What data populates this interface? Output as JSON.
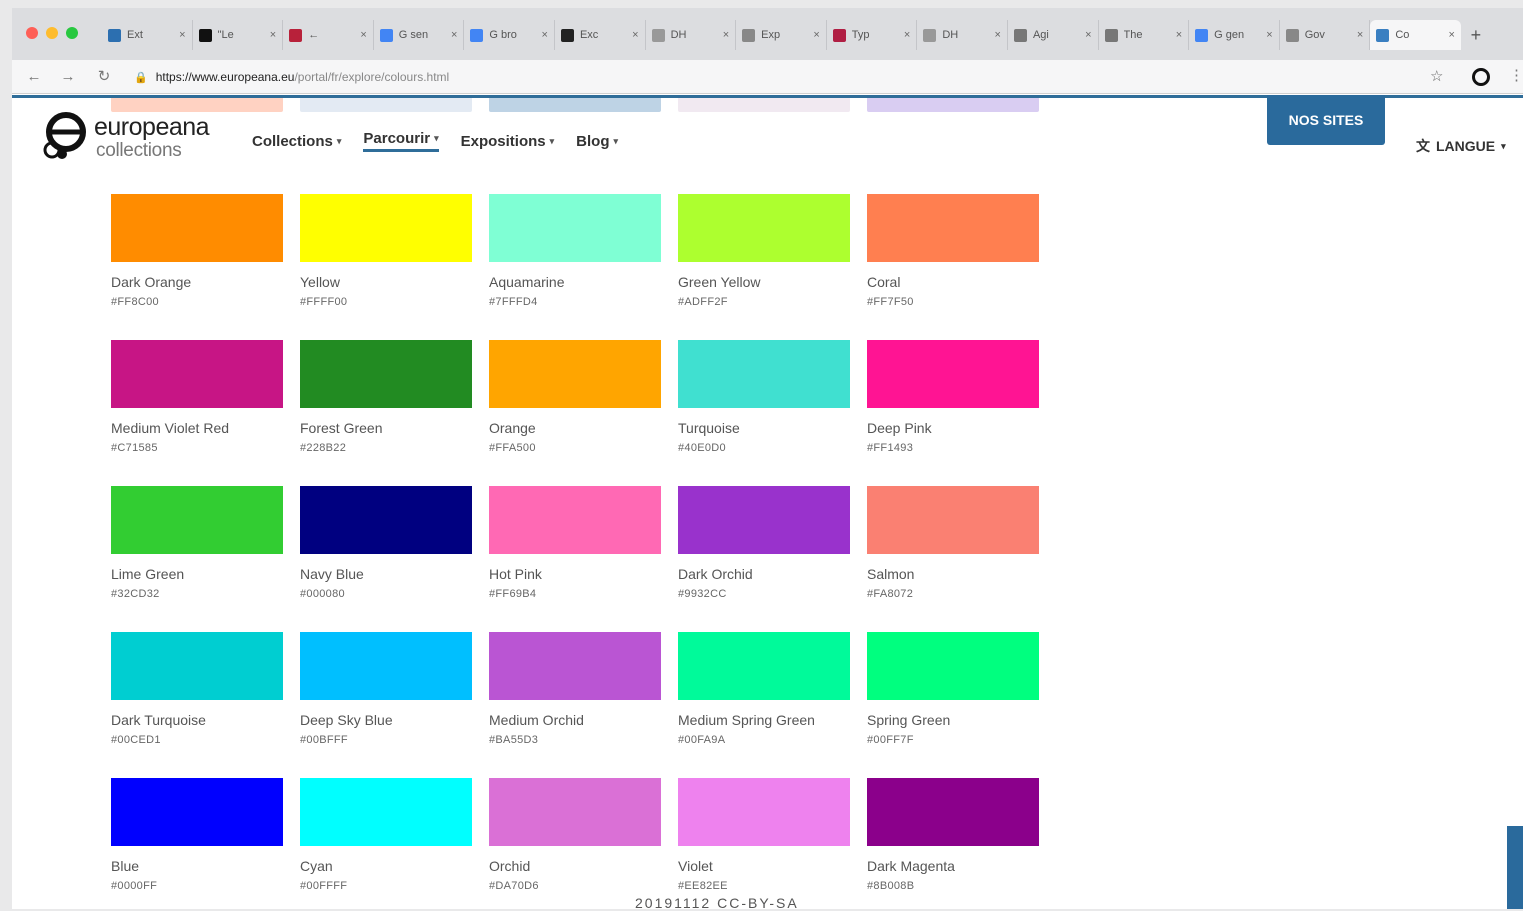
{
  "browser": {
    "tabs": [
      {
        "title": "Ext",
        "color": "#2c6fb0"
      },
      {
        "title": "\"Le",
        "color": "#111111"
      },
      {
        "title": "←",
        "color": "#b8213a"
      },
      {
        "title": "G sen",
        "color": "#4285f4"
      },
      {
        "title": "G bro",
        "color": "#4285f4"
      },
      {
        "title": "Exc",
        "color": "#222222"
      },
      {
        "title": "DH",
        "color": "#999999"
      },
      {
        "title": "Exp",
        "color": "#888888"
      },
      {
        "title": "Typ",
        "color": "#b01e43"
      },
      {
        "title": "DH",
        "color": "#999999"
      },
      {
        "title": "Agi",
        "color": "#777777"
      },
      {
        "title": "The",
        "color": "#777777"
      },
      {
        "title": "G gen",
        "color": "#4285f4"
      },
      {
        "title": "Gov",
        "color": "#888888"
      },
      {
        "title": "Co",
        "color": "#3a7fc1"
      }
    ],
    "active_tab": 14,
    "url_host": "https://www.europeana.eu",
    "url_path": "/portal/fr/explore/colours.html"
  },
  "header": {
    "logo_line1": "europeana",
    "logo_line2": "collections",
    "nav": [
      {
        "label": "Collections",
        "active": false
      },
      {
        "label": "Parcourir",
        "active": true
      },
      {
        "label": "Expositions",
        "active": false
      },
      {
        "label": "Blog",
        "active": false
      }
    ],
    "nos_sites": "NOS SITES",
    "langue": "LANGUE"
  },
  "colours": [
    [
      {
        "name": "Dark Orange",
        "hex": "#FF8C00"
      },
      {
        "name": "Yellow",
        "hex": "#FFFF00"
      },
      {
        "name": "Aquamarine",
        "hex": "#7FFFD4"
      },
      {
        "name": "Green Yellow",
        "hex": "#ADFF2F"
      },
      {
        "name": "Coral",
        "hex": "#FF7F50"
      }
    ],
    [
      {
        "name": "Medium Violet Red",
        "hex": "#C71585"
      },
      {
        "name": "Forest Green",
        "hex": "#228B22"
      },
      {
        "name": "Orange",
        "hex": "#FFA500"
      },
      {
        "name": "Turquoise",
        "hex": "#40E0D0"
      },
      {
        "name": "Deep Pink",
        "hex": "#FF1493"
      }
    ],
    [
      {
        "name": "Lime Green",
        "hex": "#32CD32"
      },
      {
        "name": "Navy Blue",
        "hex": "#000080"
      },
      {
        "name": "Hot Pink",
        "hex": "#FF69B4"
      },
      {
        "name": "Dark Orchid",
        "hex": "#9932CC"
      },
      {
        "name": "Salmon",
        "hex": "#FA8072"
      }
    ],
    [
      {
        "name": "Dark Turquoise",
        "hex": "#00CED1"
      },
      {
        "name": "Deep Sky Blue",
        "hex": "#00BFFF"
      },
      {
        "name": "Medium Orchid",
        "hex": "#BA55D3"
      },
      {
        "name": "Medium Spring Green",
        "hex": "#00FA9A"
      },
      {
        "name": "Spring Green",
        "hex": "#00FF7F"
      }
    ],
    [
      {
        "name": "Blue",
        "hex": "#0000FF"
      },
      {
        "name": "Cyan",
        "hex": "#00FFFF"
      },
      {
        "name": "Orchid",
        "hex": "#DA70D6"
      },
      {
        "name": "Violet",
        "hex": "#EE82EE"
      },
      {
        "name": "Dark Magenta",
        "hex": "#8B008B"
      }
    ]
  ],
  "brand_color": "#2A6A9C",
  "caption": "20191112 CC-BY-SA"
}
